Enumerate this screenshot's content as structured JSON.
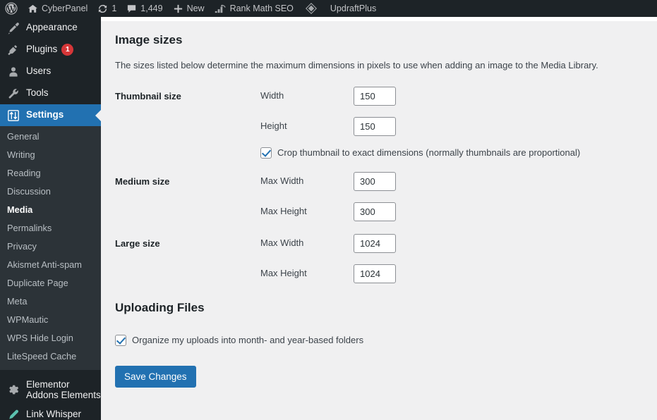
{
  "adminbar": {
    "items": [
      {
        "icon": "wordpress-logo-icon",
        "label": ""
      },
      {
        "icon": "home-icon",
        "label": "CyberPanel"
      },
      {
        "icon": "updates-icon",
        "label": "1"
      },
      {
        "icon": "comment-bubble-icon",
        "label": "1,449"
      },
      {
        "icon": "plus-icon",
        "label": "New"
      },
      {
        "icon": "rank-math-icon",
        "label": "Rank Math SEO"
      },
      {
        "icon": "updraftplus-icon",
        "label": "UpdraftPlus"
      }
    ]
  },
  "sidebar": {
    "top_items": [
      {
        "icon": "appearance-brush-icon",
        "label": "Appearance",
        "badge": ""
      },
      {
        "icon": "plugins-plug-icon",
        "label": "Plugins",
        "badge": "1"
      },
      {
        "icon": "users-person-icon",
        "label": "Users",
        "badge": ""
      },
      {
        "icon": "tools-wrench-icon",
        "label": "Tools",
        "badge": ""
      }
    ],
    "settings": {
      "icon": "settings-sliders-icon",
      "label": "Settings",
      "current": true
    },
    "submenu": [
      {
        "label": "General",
        "current": false
      },
      {
        "label": "Writing",
        "current": false
      },
      {
        "label": "Reading",
        "current": false
      },
      {
        "label": "Discussion",
        "current": false
      },
      {
        "label": "Media",
        "current": true
      },
      {
        "label": "Permalinks",
        "current": false
      },
      {
        "label": "Privacy",
        "current": false
      },
      {
        "label": "Akismet Anti-spam",
        "current": false
      },
      {
        "label": "Duplicate Page",
        "current": false
      },
      {
        "label": "Meta",
        "current": false
      },
      {
        "label": "WPMautic",
        "current": false
      },
      {
        "label": "WPS Hide Login",
        "current": false
      },
      {
        "label": "LiteSpeed Cache",
        "current": false
      }
    ],
    "bottom_items": [
      {
        "icon": "gear-icon",
        "label": "Elementor Addons Elements"
      },
      {
        "icon": "link-whisper-pencil-icon",
        "label": "Link Whisper"
      }
    ]
  },
  "main": {
    "image_sizes_heading": "Image sizes",
    "image_sizes_description": "The sizes listed below determine the maximum dimensions in pixels to use when adding an image to the Media Library.",
    "thumbnail": {
      "row_label": "Thumbnail size",
      "width_label": "Width",
      "width_value": "150",
      "height_label": "Height",
      "height_value": "150",
      "crop_label": "Crop thumbnail to exact dimensions (normally thumbnails are proportional)",
      "crop_checked": true
    },
    "medium": {
      "row_label": "Medium size",
      "width_label": "Max Width",
      "width_value": "300",
      "height_label": "Max Height",
      "height_value": "300"
    },
    "large": {
      "row_label": "Large size",
      "width_label": "Max Width",
      "width_value": "1024",
      "height_label": "Max Height",
      "height_value": "1024"
    },
    "uploading_heading": "Uploading Files",
    "organize_label": "Organize my uploads into month- and year-based folders",
    "organize_checked": true,
    "save_button": "Save Changes"
  },
  "colors": {
    "admin_dark": "#1d2327",
    "submenu_dark": "#2c3338",
    "accent_blue": "#2271b1",
    "badge_red": "#d63638",
    "content_bg": "#f0f0f1"
  }
}
